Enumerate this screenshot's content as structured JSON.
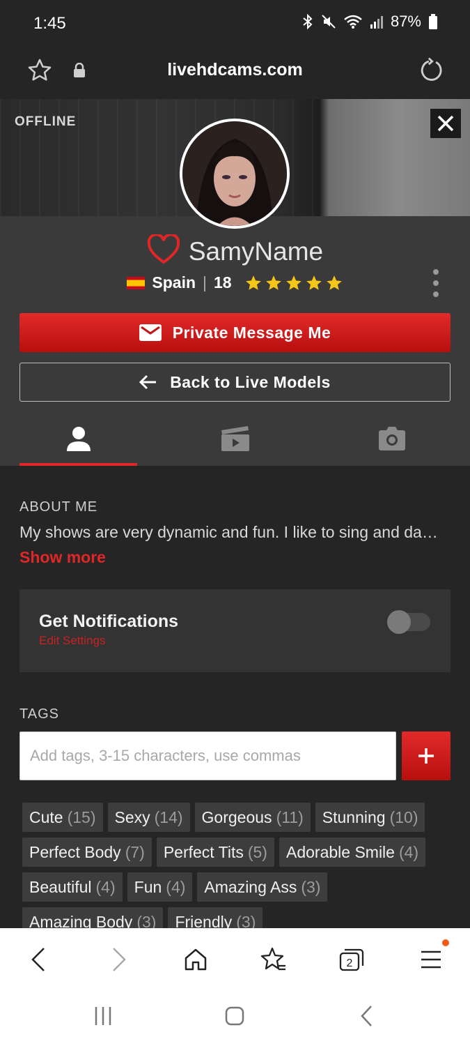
{
  "status_bar": {
    "time": "1:45",
    "battery": "87%",
    "icons": [
      "bluetooth-icon",
      "mute-icon",
      "wifi-icon",
      "signal-icon",
      "battery-icon"
    ]
  },
  "browser": {
    "url": "livehdcams.com",
    "tab_count": "2"
  },
  "profile": {
    "status": "OFFLINE",
    "name": "SamyName",
    "country": "Spain",
    "age": "18",
    "rating": 5,
    "private_message_label": "Private Message Me",
    "back_label": "Back to Live Models"
  },
  "tabs": [
    {
      "name": "profile",
      "icon": "user-icon",
      "active": true
    },
    {
      "name": "videos",
      "icon": "video-icon",
      "active": false
    },
    {
      "name": "photos",
      "icon": "camera-icon",
      "active": false
    }
  ],
  "about": {
    "title": "ABOUT ME",
    "text": "My shows are very dynamic and fun. I like to sing and dance",
    "show_more": "Show more"
  },
  "notifications": {
    "title": "Get Notifications",
    "edit_link": "Edit Settings",
    "enabled": false
  },
  "tags_section": {
    "title": "TAGS",
    "input_placeholder": "Add tags, 3-15 characters, use commas",
    "tags": [
      {
        "label": "Cute",
        "count": "(15)"
      },
      {
        "label": "Sexy",
        "count": "(14)"
      },
      {
        "label": "Gorgeous",
        "count": "(11)"
      },
      {
        "label": "Stunning",
        "count": "(10)"
      },
      {
        "label": "Perfect Body",
        "count": "(7)"
      },
      {
        "label": "Perfect Tits",
        "count": "(5)"
      },
      {
        "label": "Adorable Smile",
        "count": "(4)"
      },
      {
        "label": "Beautiful",
        "count": "(4)"
      },
      {
        "label": "Fun",
        "count": "(4)"
      },
      {
        "label": "Amazing Ass",
        "count": "(3)"
      },
      {
        "label": "Amazing Body",
        "count": "(3)"
      },
      {
        "label": "Friendly",
        "count": "(3)"
      }
    ]
  },
  "colors": {
    "accent": "#e02626",
    "background": "#252525",
    "panel": "#3a3a3a",
    "star": "#f5c518"
  }
}
